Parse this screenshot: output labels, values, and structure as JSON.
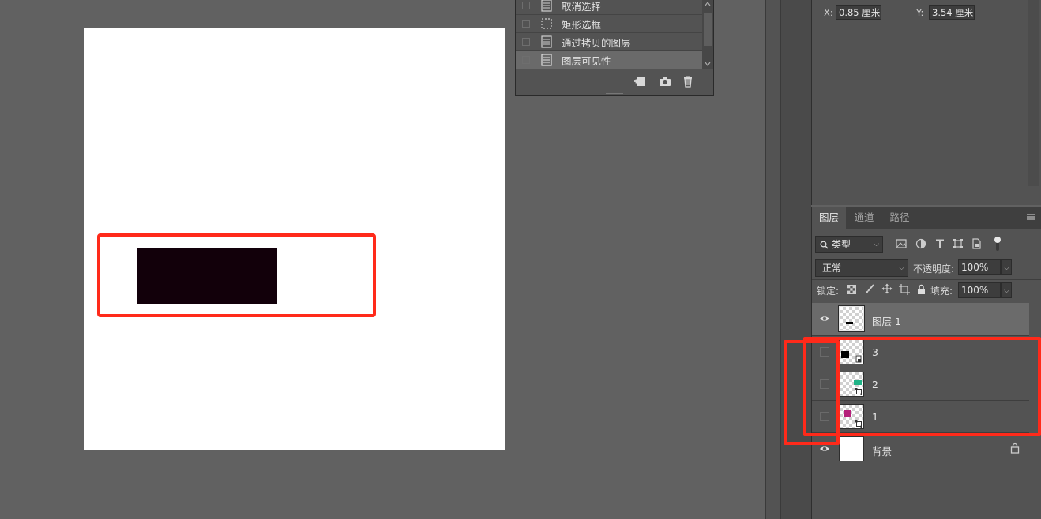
{
  "history": {
    "items": [
      {
        "label": "取消选择",
        "icon": "document-icon"
      },
      {
        "label": "矩形选框",
        "icon": "marquee-icon"
      },
      {
        "label": "通过拷贝的图层",
        "icon": "document-icon"
      },
      {
        "label": "图层可见性",
        "icon": "document-icon",
        "active": true
      }
    ],
    "tools": [
      "new-snapshot-icon",
      "camera-icon",
      "trash-icon"
    ]
  },
  "properties": {
    "x_label": "X:",
    "x_value": "0.85 厘米",
    "y_label": "Y:",
    "y_value": "3.54 厘米"
  },
  "layers_panel": {
    "tabs": [
      {
        "label": "图层",
        "active": true
      },
      {
        "label": "通道"
      },
      {
        "label": "路径"
      }
    ],
    "filter_kind": "类型",
    "blend_mode": "正常",
    "opacity_label": "不透明度:",
    "opacity_value": "100%",
    "lock_label": "锁定:",
    "fill_label": "填充:",
    "fill_value": "100%",
    "layers": [
      {
        "name": "图层 1",
        "visible": true,
        "selected": true
      },
      {
        "name": "3",
        "visible": false,
        "swatch": "#000000"
      },
      {
        "name": "2",
        "visible": false,
        "swatch": "#1fb386"
      },
      {
        "name": "1",
        "visible": false,
        "swatch": "#b5207a"
      },
      {
        "name": "背景",
        "visible": true,
        "locked": true
      }
    ]
  },
  "colors": {
    "canvas_rect": "#12000a",
    "annotation": "#ff2a1a"
  }
}
